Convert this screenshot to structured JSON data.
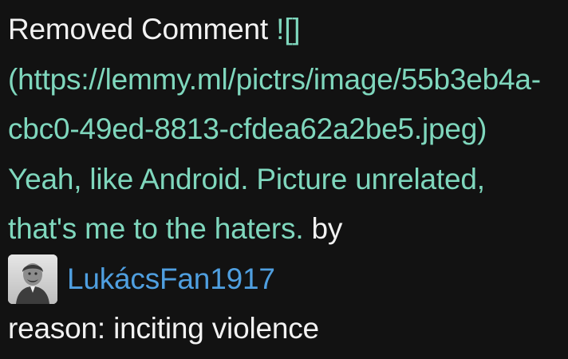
{
  "comment": {
    "label": "Removed Comment",
    "link_text": "![](https://lemmy.ml/pictrs/image/55b3eb4a-cbc0-49ed-8813-cfdea62a2be5.jpeg) Yeah, like Android. Picture unrelated, that's me to the haters.",
    "by_text": "by"
  },
  "author": {
    "name": "LukácsFan1917",
    "avatar_icon": "user-avatar-portrait"
  },
  "reason": {
    "text": "reason: inciting violence"
  },
  "colors": {
    "background": "#121212",
    "text": "#f2f2f2",
    "link": "#7fd7bd",
    "author": "#4f9fe0"
  }
}
